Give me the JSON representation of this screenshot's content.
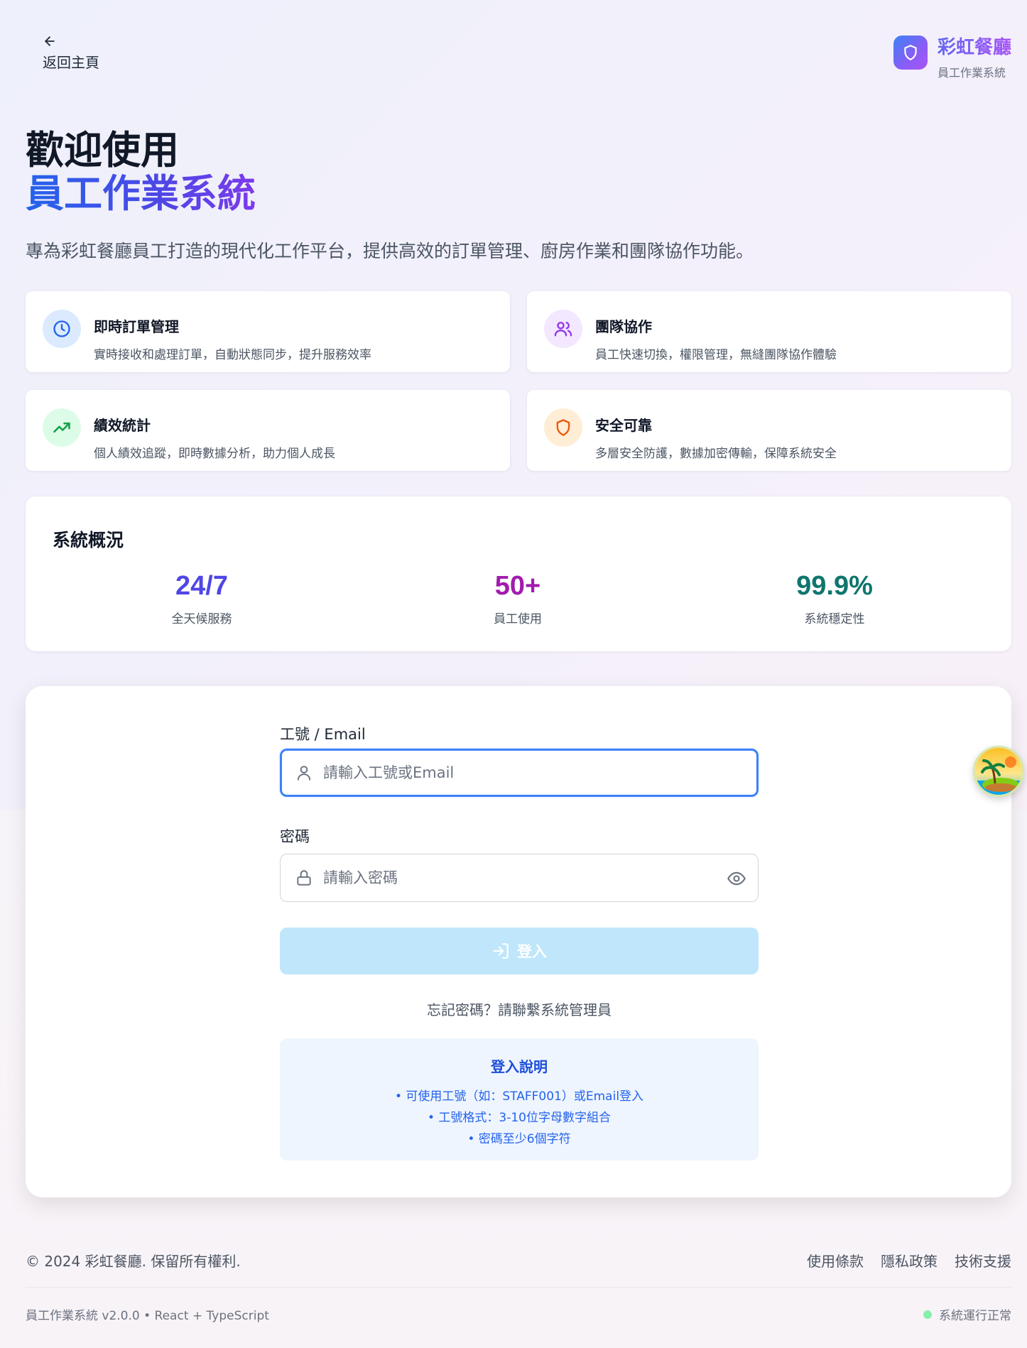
{
  "nav": {
    "back_label": "返回主頁"
  },
  "brand": {
    "name": "彩虹餐廳",
    "subtitle": "員工作業系統",
    "logo_icon": "shield-icon"
  },
  "hero": {
    "title_line1": "歡迎使用",
    "title_line2": "員工作業系統",
    "description": "專為彩虹餐廳員工打造的現代化工作平台，提供高效的訂單管理、廚房作業和團隊協作功能。"
  },
  "features": [
    {
      "title": "即時訂單管理",
      "desc": "實時接收和處理訂單，自動狀態同步，提升服務效率",
      "icon": "clock-icon",
      "color": "#2563eb",
      "bg": "#dbeafe"
    },
    {
      "title": "團隊協作",
      "desc": "員工快速切換，權限管理，無縫團隊協作體驗",
      "icon": "users-icon",
      "color": "#9333ea",
      "bg": "#f3e8ff"
    },
    {
      "title": "績效統計",
      "desc": "個人績效追蹤，即時數據分析，助力個人成長",
      "icon": "trending-up-icon",
      "color": "#16a34a",
      "bg": "#dcfce7"
    },
    {
      "title": "安全可靠",
      "desc": "多層安全防護，數據加密傳輸，保障系統安全",
      "icon": "shield-icon",
      "color": "#ea580c",
      "bg": "#ffedd5"
    }
  ],
  "stats": {
    "title": "系統概況",
    "items": [
      {
        "value": "24/7",
        "label": "全天候服務",
        "color": "#4f46e5"
      },
      {
        "value": "50+",
        "label": "員工使用",
        "color": "#a21caf"
      },
      {
        "value": "99.9%",
        "label": "系統穩定性",
        "color": "#0f766e"
      }
    ]
  },
  "login": {
    "id_label": "工號 / Email",
    "id_placeholder": "請輸入工號或Email",
    "id_value": "",
    "password_label": "密碼",
    "password_placeholder": "請輸入密碼",
    "password_value": "",
    "submit_label": "登入",
    "forgot_text": "忘記密碼？請聯繫系統管理員",
    "help_title": "登入說明",
    "help_items": [
      "• 可使用工號（如：STAFF001）或Email登入",
      "• 工號格式：3-10位字母數字組合",
      "• 密碼至少6個字符"
    ]
  },
  "footer": {
    "copyright": "© 2024 彩虹餐廳. 保留所有權利.",
    "links": [
      "使用條款",
      "隱私政策",
      "技術支援"
    ],
    "version": "員工作業系統 v2.0.0 • React + TypeScript",
    "status": "系統運行正常",
    "status_color": "#86efac"
  }
}
